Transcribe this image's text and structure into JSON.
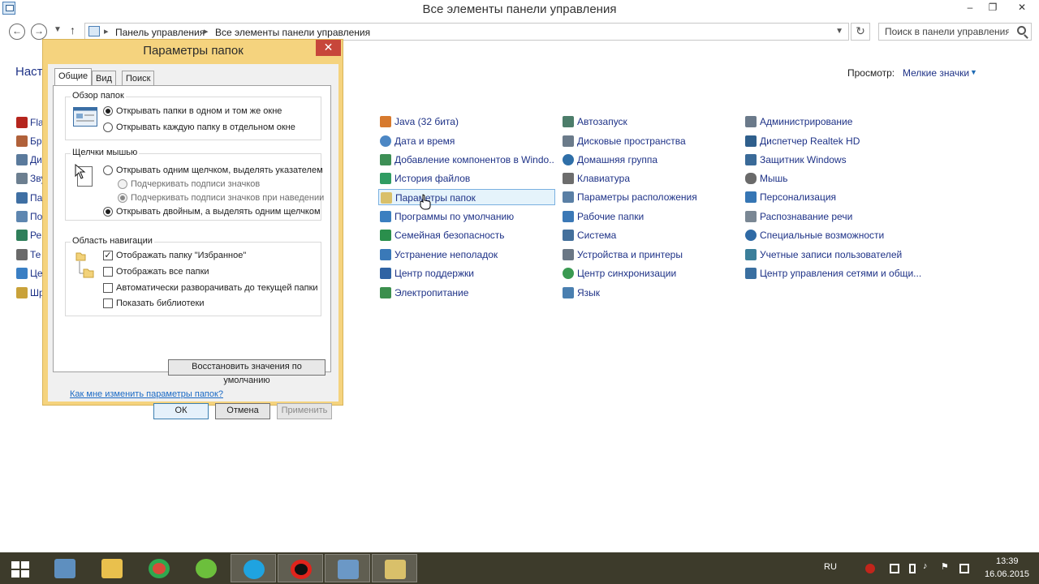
{
  "window": {
    "title": "Все элементы панели управления",
    "minimize": "–",
    "maximize": "❐",
    "close": "✕"
  },
  "nav": {
    "back": "←",
    "forward": "→",
    "up": "↑",
    "breadcrumbs": [
      "Панель управления",
      "Все элементы панели управления"
    ],
    "refresh": "↻",
    "search_placeholder": "Поиск в панели управления"
  },
  "content": {
    "header_partial": "Настр",
    "view_label": "Просмотр:",
    "view_value": "Мелкие значки",
    "left_column": [
      "Fla",
      "Бра",
      "Ди",
      "Зву",
      "Па",
      "По",
      "Ре",
      "Те",
      "Це",
      "Шр"
    ],
    "column1": [
      "Java (32 бита)",
      "Дата и время",
      "Добавление компонентов в Windo...",
      "История файлов",
      "Параметры папок",
      "Программы по умолчанию",
      "Семейная безопасность",
      "Устранение неполадок",
      "Центр поддержки",
      "Электропитание"
    ],
    "column2": [
      "Автозапуск",
      "Дисковые пространства",
      "Домашняя группа",
      "Клавиатура",
      "Параметры расположения",
      "Рабочие папки",
      "Система",
      "Устройства и принтеры",
      "Центр синхронизации",
      "Язык"
    ],
    "column3": [
      "Администрирование",
      "Диспетчер Realtek HD",
      "Защитник Windows",
      "Мышь",
      "Персонализация",
      "Распознавание речи",
      "Специальные возможности",
      "Учетные записи пользователей",
      "Центр управления сетями и общи..."
    ]
  },
  "dialog": {
    "title": "Параметры папок",
    "close": "✕",
    "tabs": [
      "Общие",
      "Вид",
      "Поиск"
    ],
    "browse": {
      "legend": "Обзор папок",
      "options": [
        "Открывать папки в одном и том же окне",
        "Открывать каждую папку в отдельном окне"
      ]
    },
    "clicks": {
      "legend": "Щелчки мышью",
      "options": [
        "Открывать одним щелчком, выделять указателем",
        "Подчеркивать подписи значков",
        "Подчеркивать подписи значков при наведении",
        "Открывать двойным, а выделять одним щелчком"
      ]
    },
    "navpane": {
      "legend": "Область навигации",
      "options": [
        "Отображать папку \"Избранное\"",
        "Отображать все папки",
        "Автоматически разворачивать до текущей папки",
        "Показать библиотеки"
      ]
    },
    "restore_button": "Восстановить значения по умолчанию",
    "help_link": "Как мне изменить параметры папок?",
    "ok": "ОК",
    "cancel": "Отмена",
    "apply": "Применить"
  },
  "taskbar": {
    "lang": "RU",
    "time": "13:39",
    "date": "16.06.2015"
  }
}
